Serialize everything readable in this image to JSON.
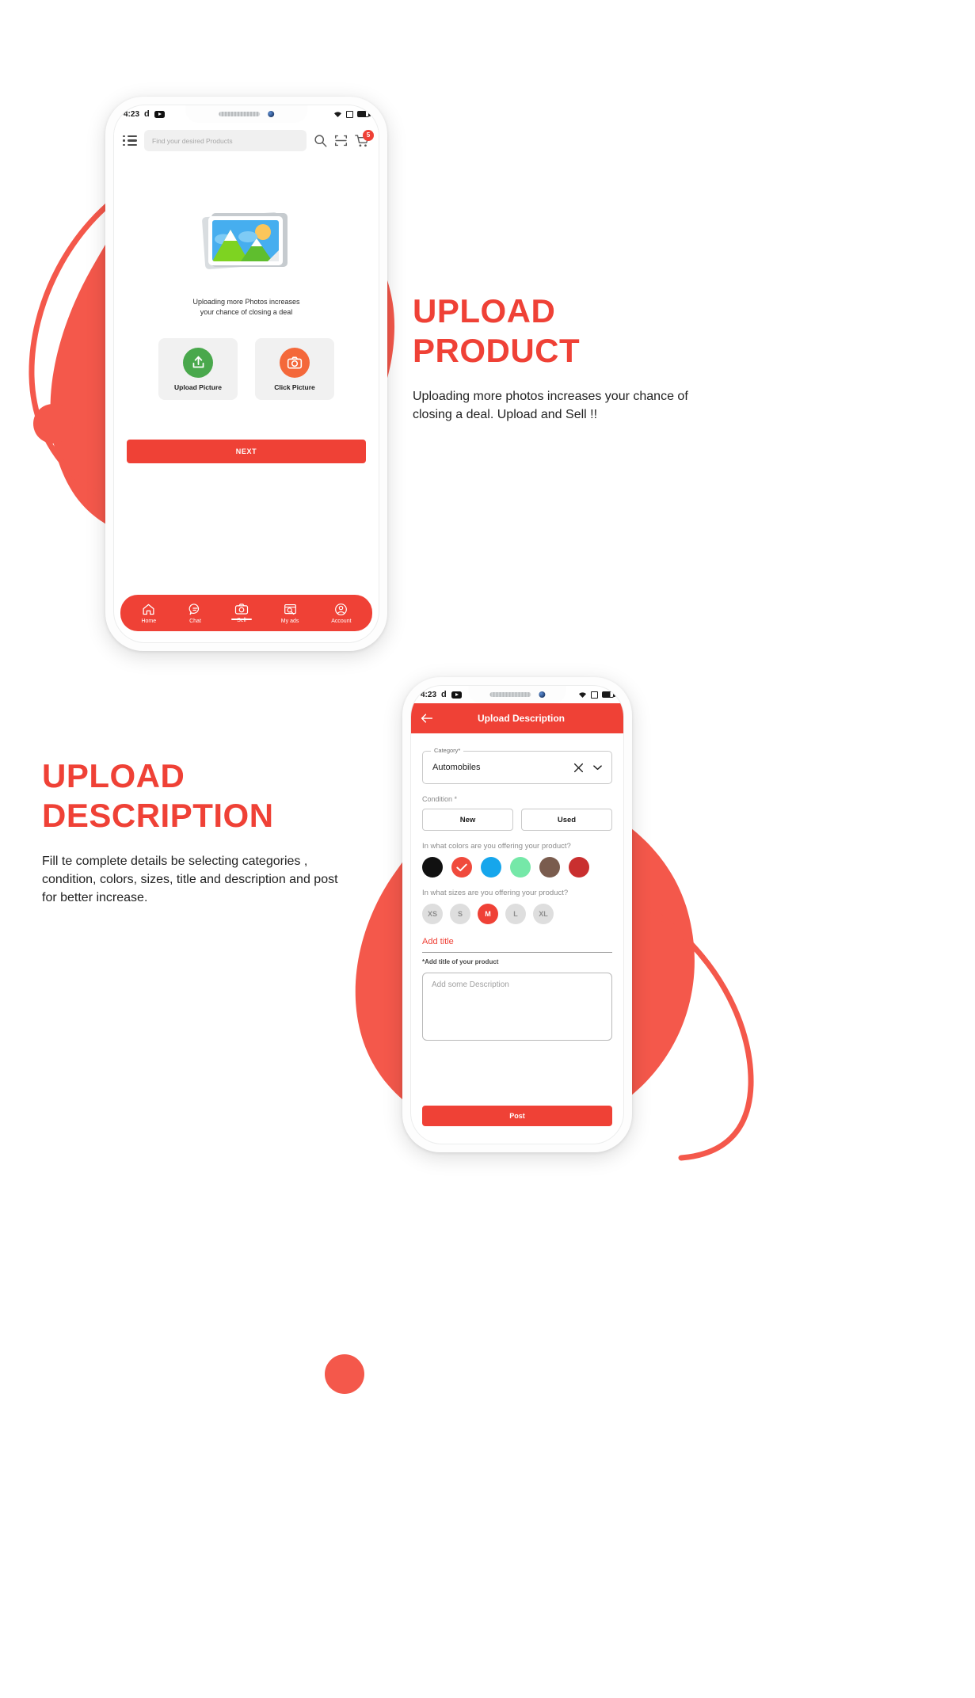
{
  "colors": {
    "brand_red": "#EF4136",
    "green": "#49A84C",
    "orange": "#F4683A"
  },
  "section_one": {
    "heading_line1": "UPLOAD",
    "heading_line2": "PRODUCT",
    "paragraph": "Uploading more photos increases your chance of closing a deal. Upload and Sell !!",
    "phone": {
      "status_bar": {
        "time": "4:23",
        "app_glyph": "d",
        "media_icon": "youtube-icon"
      },
      "app_bar": {
        "menu_icon": "hamburger-menu-icon",
        "search_placeholder": "Find your desired Products",
        "search_icon": "search-icon",
        "scan_icon": "scan-barcode-icon",
        "cart_icon": "shopping-cart-icon",
        "cart_badge": "5"
      },
      "content": {
        "illustration": "photo-gallery-image",
        "hint_line1": "Uploading more Photos increases",
        "hint_line2": "your chance of closing a deal",
        "choices": [
          {
            "label": "Upload Picture",
            "icon": "upload-icon",
            "color": "#49A84C"
          },
          {
            "label": "Click Picture",
            "icon": "camera-icon",
            "color": "#F4683A"
          }
        ],
        "next_label": "NEXT"
      },
      "bottom_nav": [
        {
          "label": "Home",
          "icon": "home-icon",
          "active": false
        },
        {
          "label": "Chat",
          "icon": "chat-bubble-icon",
          "active": false
        },
        {
          "label": "Sell",
          "icon": "camera-icon",
          "active": true
        },
        {
          "label": "My ads",
          "icon": "my-ads-icon",
          "active": false
        },
        {
          "label": "Account",
          "icon": "account-user-icon",
          "active": false
        }
      ]
    }
  },
  "section_two": {
    "heading_line1": "UPLOAD",
    "heading_line2": "DESCRIPTION",
    "paragraph": "Fill te complete details  be selecting categories , condition, colors, sizes, title and description and post for better increase.",
    "phone": {
      "status_bar": {
        "time": "4:23",
        "app_glyph": "d",
        "media_icon": "youtube-icon"
      },
      "app_bar": {
        "back_icon": "arrow-left-icon",
        "title": "Upload Description"
      },
      "form": {
        "category_legend": "Category*",
        "category_value": "Automobiles",
        "category_clear_icon": "close-x-icon",
        "category_dropdown_icon": "chevron-down-icon",
        "condition_label": "Condition *",
        "condition_options": [
          "New",
          "Used"
        ],
        "colors_question": "In what colors are you offering your product?",
        "colors": [
          {
            "name": "black",
            "hex": "#111111",
            "selected": false
          },
          {
            "name": "red",
            "hex": "#F04A3C",
            "selected": true
          },
          {
            "name": "blue",
            "hex": "#16A6EC",
            "selected": false
          },
          {
            "name": "mint-green",
            "hex": "#75E8A8",
            "selected": false
          },
          {
            "name": "brown",
            "hex": "#7A5C4E",
            "selected": false
          },
          {
            "name": "dark-red",
            "hex": "#C92F2F",
            "selected": false
          }
        ],
        "sizes_question": "In what sizes are you offering your product?",
        "sizes": [
          {
            "label": "XS",
            "selected": false
          },
          {
            "label": "S",
            "selected": false
          },
          {
            "label": "M",
            "selected": true
          },
          {
            "label": "L",
            "selected": false
          },
          {
            "label": "XL",
            "selected": false
          }
        ],
        "add_title_link": "Add title",
        "title_helper": "*Add title of your product",
        "description_placeholder": "Add some Description",
        "post_label": "Post"
      }
    }
  }
}
